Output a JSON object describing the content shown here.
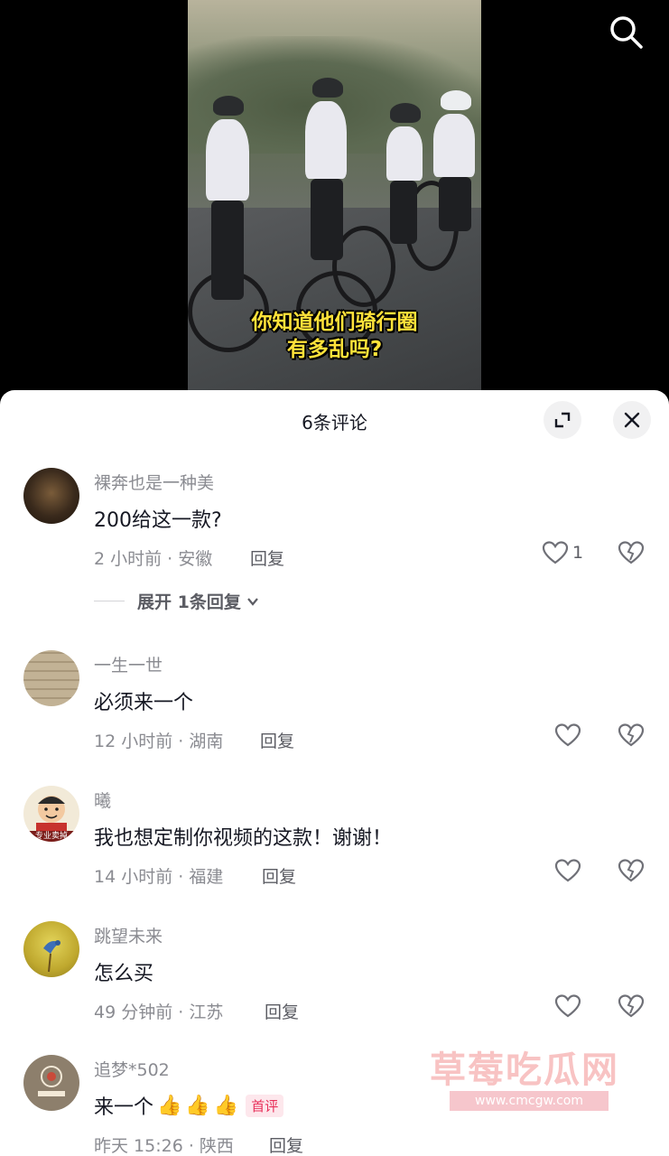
{
  "video": {
    "caption_line1": "你知道他们骑行圈",
    "caption_line2": "有多乱吗?",
    "search_icon": "search-icon"
  },
  "sheet": {
    "title": "6条评论",
    "expand_icon": "fullscreen-icon",
    "close_icon": "close-icon"
  },
  "comments": [
    {
      "username": "裸奔也是一种美",
      "text": "200给这一款?",
      "meta": "2 小时前 · 安徽",
      "reply_label": "回复",
      "like_count": "1",
      "expand_replies": "展开 1条回复",
      "avatar_color": "#5a4632"
    },
    {
      "username": "一生一世",
      "text": "必须来一个",
      "meta": "12 小时前 · 湖南",
      "reply_label": "回复",
      "avatar_color": "#b8a88c"
    },
    {
      "username": "曦",
      "text": "我也想定制你视频的这款！谢谢！",
      "meta": "14 小时前 · 福建",
      "reply_label": "回复",
      "avatar_label": "专业卖掉",
      "avatar_color": "#f0e6d2"
    },
    {
      "username": "跳望未来",
      "text": "怎么买",
      "meta": "49 分钟前 · 江苏",
      "reply_label": "回复",
      "avatar_color": "#c9b13a"
    },
    {
      "username": "追梦*502",
      "text": "来一个",
      "emoji": "👍",
      "badge": "首评",
      "meta": "昨天 15:26 · 陕西",
      "reply_label": "回复",
      "avatar_color": "#9c8c78"
    }
  ],
  "watermark": {
    "title": "草莓吃瓜网",
    "url": "www.cmcgw.com"
  }
}
